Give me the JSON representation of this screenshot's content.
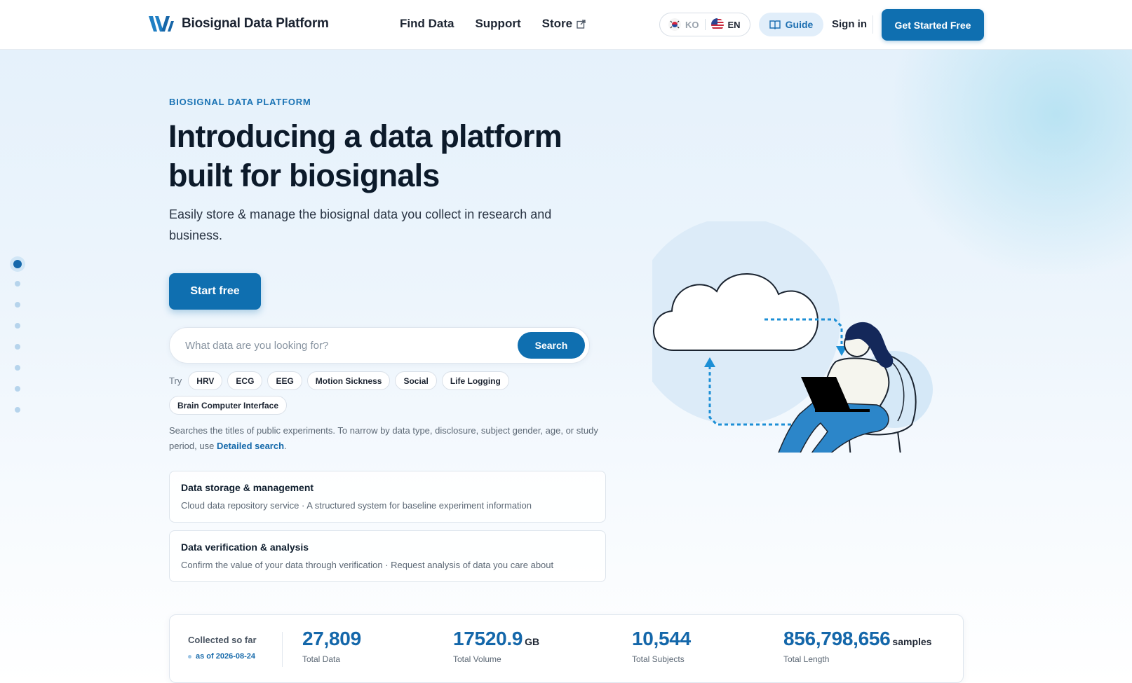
{
  "header": {
    "logo_text": "Biosignal Data Platform",
    "nav": [
      {
        "label": "Find Data"
      },
      {
        "label": "Support"
      },
      {
        "label": "Store"
      }
    ],
    "lang": {
      "ko": "KO",
      "en": "EN"
    },
    "guide_label": "Guide",
    "signin_label": "Sign in",
    "cta_label": "Get Started Free"
  },
  "hero": {
    "eyebrow": "BIOSIGNAL DATA PLATFORM",
    "headline_line1": "Introducing a data platform",
    "headline_line2": "built for biosignals",
    "subhead": "Easily store & manage the biosignal data you collect in research and business.",
    "start_label": "Start free",
    "search": {
      "placeholder": "What data are you looking for?",
      "button_label": "Search"
    },
    "try_label": "Try",
    "chips": [
      "HRV",
      "ECG",
      "EEG",
      "Motion Sickness",
      "Social",
      "Life Logging",
      "Brain Computer Interface"
    ],
    "hint_text": "Searches the titles of public experiments. To narrow by data type, disclosure, subject gender, age, or study period, use ",
    "hint_link": "Detailed search",
    "hint_end": ".",
    "features": [
      {
        "title": "Data storage & management",
        "desc": "Cloud data repository service · A structured system for baseline experiment information"
      },
      {
        "title": "Data verification & analysis",
        "desc": "Confirm the value of your data through verification · Request analysis of data you care about"
      }
    ]
  },
  "stats": {
    "collected_label": "Collected so far",
    "as_of": "as of 2026-08-24",
    "items": [
      {
        "value": "27,809",
        "unit": "",
        "label": "Total Data"
      },
      {
        "value": "17520.9",
        "unit": "GB",
        "label": "Total Volume"
      },
      {
        "value": "10,544",
        "unit": "",
        "label": "Total Subjects"
      },
      {
        "value": "856,798,656",
        "unit": "samples",
        "label": "Total Length"
      }
    ]
  },
  "pager": {
    "count": 8,
    "active": 0
  },
  "colors": {
    "brand": "#0f6fb0",
    "accent_light": "#e1eefa"
  },
  "icons": [
    "logo-mark-icon",
    "external-link-icon",
    "korea-flag-icon",
    "us-flag-icon",
    "book-icon"
  ]
}
